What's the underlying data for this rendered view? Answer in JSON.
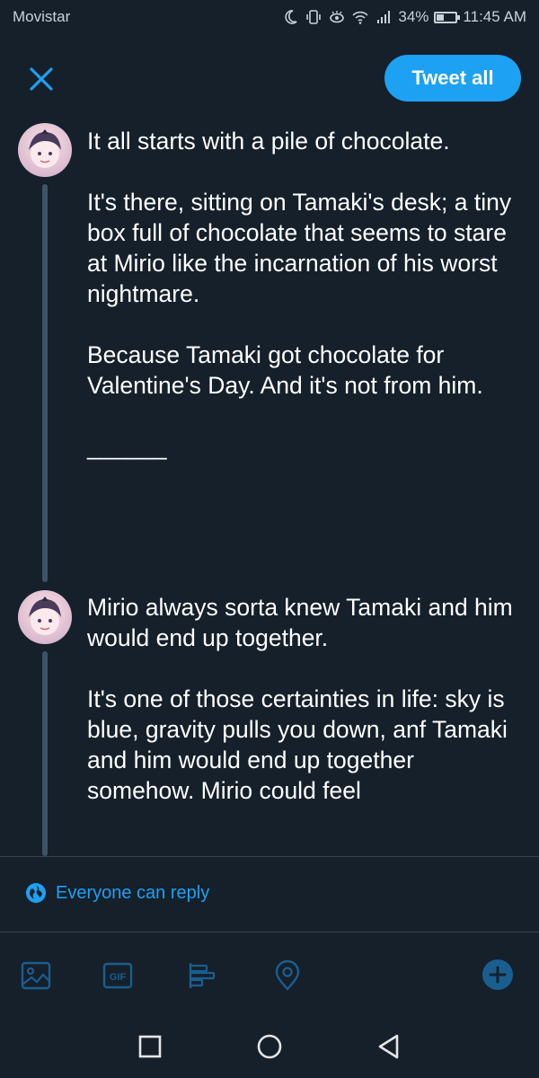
{
  "status_bar": {
    "carrier": "Movistar",
    "battery": "34%",
    "battery_level": 0.34,
    "time": "11:45 AM"
  },
  "header": {
    "close_icon": "close-icon",
    "tweet_all_label": "Tweet all"
  },
  "thread": [
    {
      "text": "It all starts with a pile of chocolate.\n\nIt's there, sitting on Tamaki's desk; a tiny box full of chocolate that seems to stare at Mirio like the incarnation of his worst nightmare.\n\nBecause Tamaki got chocolate for Valentine's Day. And it's not from him.\n\n______"
    },
    {
      "text": "Mirio always sorta knew Tamaki and him would end up together.\n\nIt's one of those certainties in life: sky is blue, gravity pulls you down, anf Tamaki and him would end up together somehow. Mirio could feel"
    }
  ],
  "reply_setting": {
    "icon": "globe-icon",
    "label": "Everyone can reply"
  },
  "toolbar": {
    "icons": [
      "image-icon",
      "gif-icon",
      "poll-icon",
      "location-icon",
      "add-icon"
    ],
    "gif_label": "GIF"
  },
  "navbar": {
    "icons": [
      "recents-square-icon",
      "home-circle-icon",
      "back-triangle-icon"
    ]
  },
  "colors": {
    "background": "#15202b",
    "accent": "#1da1f2",
    "divider": "#38444d",
    "thread_line": "#3d5466"
  }
}
